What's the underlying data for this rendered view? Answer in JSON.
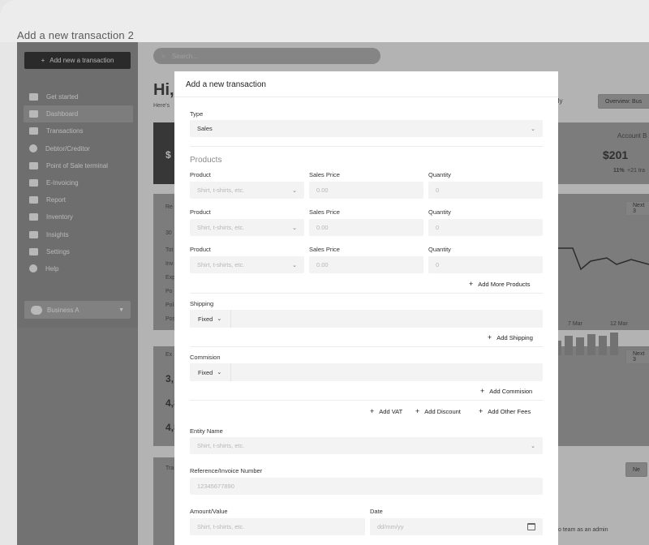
{
  "window": {
    "title": "Add a new transaction 2"
  },
  "sidebar": {
    "add_button": "Add new a transaction",
    "items": [
      {
        "label": "Get started",
        "icon": "card-icon"
      },
      {
        "label": "Dashboard",
        "icon": "dashboard-icon"
      },
      {
        "label": "Transactions",
        "icon": "card-icon"
      },
      {
        "label": "Debtor/Creditor",
        "icon": "dollar-icon"
      },
      {
        "label": "Point of Sale terminal",
        "icon": "card-icon"
      },
      {
        "label": "E-Invoicing",
        "icon": "invoice-icon"
      },
      {
        "label": "Report",
        "icon": "report-icon"
      },
      {
        "label": "Inventory",
        "icon": "briefcase-icon"
      },
      {
        "label": "Insights",
        "icon": "person-icon"
      },
      {
        "label": "Settings",
        "icon": "settings-icon"
      },
      {
        "label": "Help",
        "icon": "help-icon"
      }
    ],
    "business": "Business A"
  },
  "background": {
    "search_placeholder": "Search...",
    "greeting": "Hi,",
    "greeting_sub": "Here's",
    "period": "thly",
    "overview": "Overview: Bus",
    "account": "Account B",
    "amount": "$201",
    "change": "11%",
    "change_sub": "+21 tra",
    "dollar_left": "$",
    "next_1": "Next 3",
    "next_2": "Next 3",
    "next_3": "Ne",
    "axis_1": "7 Mar",
    "axis_2": "12 Mar",
    "ex_label": "Ex",
    "tr_label": "Tra",
    "val_1": "3,",
    "val_2": "4,8",
    "val_3": "4,8",
    "footer_text": "o team as an admin",
    "rows": [
      "Re",
      "30",
      "Tot",
      "Inv",
      "Exp",
      "Po",
      "Pol",
      "Pos"
    ]
  },
  "modal": {
    "title": "Add a new transaction",
    "type_label": "Type",
    "type_value": "Sales",
    "products_heading": "Products",
    "product_rows": [
      {
        "product_label": "Product",
        "product_placeholder": "Shirt, t-shirts, etc.",
        "price_label": "Sales Price",
        "price_placeholder": "0.00",
        "qty_label": "Quantity",
        "qty_placeholder": "0"
      },
      {
        "product_label": "Product",
        "product_placeholder": "Shirt, t-shirts, etc.",
        "price_label": "Sales Price",
        "price_placeholder": "0.00",
        "qty_label": "Quantity",
        "qty_placeholder": "0"
      },
      {
        "product_label": "Product",
        "product_placeholder": "Shirt, t-shirts, etc.",
        "price_label": "Sales Price",
        "price_placeholder": "0.00",
        "qty_label": "Quantity",
        "qty_placeholder": "0"
      }
    ],
    "add_more_products": "Add More Products",
    "shipping_label": "Shipping",
    "shipping_mode": "Fixed",
    "add_shipping": "Add Shipping",
    "commission_label": "Commision",
    "commission_mode": "Fixed",
    "add_commission": "Add Commision",
    "add_vat": "Add VAT",
    "add_discount": "Add Discount",
    "add_other_fees": "Add Other Fees",
    "entity_label": "Entity Name",
    "entity_placeholder": "Shirt, t-shirts, etc.",
    "reference_label": "Reference/Invoice Number",
    "reference_placeholder": "12345677890",
    "amount_label": "Amount/Value",
    "amount_placeholder": "Shirt, t-shirts, etc.",
    "date_label": "Date",
    "date_placeholder": "dd/mm/yy"
  }
}
